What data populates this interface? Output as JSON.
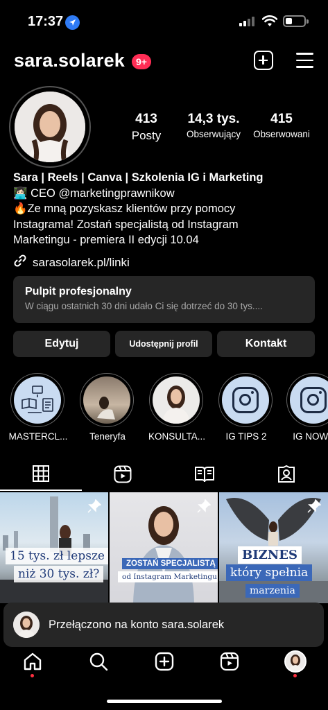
{
  "status_bar": {
    "time": "17:37"
  },
  "header": {
    "username": "sara.solarek",
    "notifications_badge": "9+"
  },
  "stats": {
    "posts": {
      "value": "413",
      "label": "Posty"
    },
    "followers": {
      "value": "14,3 tys.",
      "label": "Obserwujący"
    },
    "following": {
      "value": "415",
      "label": "Obserwowani"
    }
  },
  "bio": {
    "name": "Sara | Reels | Canva | Szkolenia IG i Marketing",
    "line1": "👩🏻‍💻 CEO @marketingprawnikow",
    "line2": "🔥Ze mną pozyskasz klientów przy pomocy",
    "line3": "Instagrama! Zostań specjalistą od Instagram",
    "line4": "Marketingu - premiera II edycji 10.04",
    "link": "sarasolarek.pl/linki"
  },
  "dashboard": {
    "title": "Pulpit profesjonalny",
    "subtitle": "W ciągu ostatnich 30 dni udało Ci się dotrzeć do 30 tys...."
  },
  "buttons": {
    "edit": "Edytuj",
    "share": "Udostępnij profil",
    "contact": "Kontakt"
  },
  "highlights": [
    {
      "label": "MASTERCL..."
    },
    {
      "label": "Teneryfa"
    },
    {
      "label": "KONSULTA..."
    },
    {
      "label": "IG TIPS 2"
    },
    {
      "label": "IG NOWO"
    }
  ],
  "posts": [
    {
      "caption1": "15 tys. zł lepsze",
      "caption2": "niż 30 tys. zł?"
    },
    {
      "caption1": "ZOSTAŃ SPECJALISTĄ",
      "caption2": "od Instagram Marketingu"
    },
    {
      "caption1": "BIZNES",
      "caption2": "który spełnia",
      "caption3": "marzenia"
    }
  ],
  "toast": {
    "text": "Przełączono na konto sara.solarek"
  },
  "colors": {
    "accent_badge": "#ff2d55",
    "location": "#2f7bf5",
    "notification_dot": "#ff3040"
  }
}
